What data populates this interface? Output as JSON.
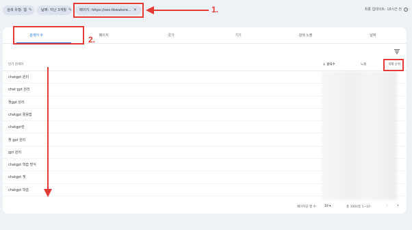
{
  "filters": {
    "search_type": "검색 유형: 웹",
    "date": "날짜: 지난 3개월",
    "page": "페이지: https://seo.tbwakore...",
    "add_label": "+"
  },
  "last_update": "최종 업데이트: 18시간 전",
  "help_label": "?",
  "annotations": {
    "label1": "1.",
    "label2": "2."
  },
  "tabs": [
    "검색어 수",
    "페이지",
    "국가",
    "기기",
    "검색 노출",
    "날짜"
  ],
  "table": {
    "headers": {
      "query": "인기 검색어",
      "clicks": "클릭수",
      "impressions": "노출",
      "ctr": "게재 순위"
    },
    "rows": [
      "chatgpt 원리",
      "chat gpt 원리",
      "챗gpt 원리",
      "chatgpt 활용법",
      "chatgpt란",
      "챗 gpt 원리",
      "gpt 원리",
      "chatgpt 학습 방식",
      "chatgpt 챗",
      "chatgpt 학습"
    ]
  },
  "footer": {
    "rows_label": "페이지당 행 수:",
    "rows_value": "10",
    "range": "총 1000중 1~10",
    "prev": "‹",
    "next": "›"
  },
  "colors": {
    "accent": "#1a73e8",
    "annotation": "#e53935"
  }
}
